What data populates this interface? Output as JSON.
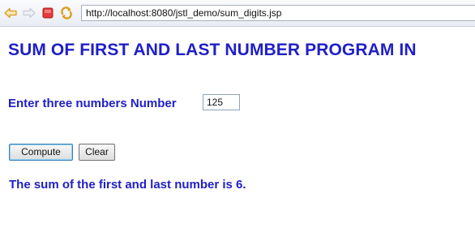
{
  "browser": {
    "url": "http://localhost:8080/jstl_demo/sum_digits.jsp",
    "icons": [
      "back-icon",
      "forward-icon",
      "stop-icon",
      "refresh-icon"
    ]
  },
  "page": {
    "title": "SUM OF FIRST AND LAST NUMBER PROGRAM IN",
    "input_label": "Enter three numbers Number",
    "input_value": "125",
    "compute_label": "Compute",
    "clear_label": "Clear",
    "result": "The sum of the first and last number is 6."
  },
  "colors": {
    "text": "#1f1fc7",
    "background": "#ffffff",
    "stop_icon": "#d42a2a",
    "refresh_icon": "#d9a21c",
    "nav_arrows": "#e4b23a"
  }
}
